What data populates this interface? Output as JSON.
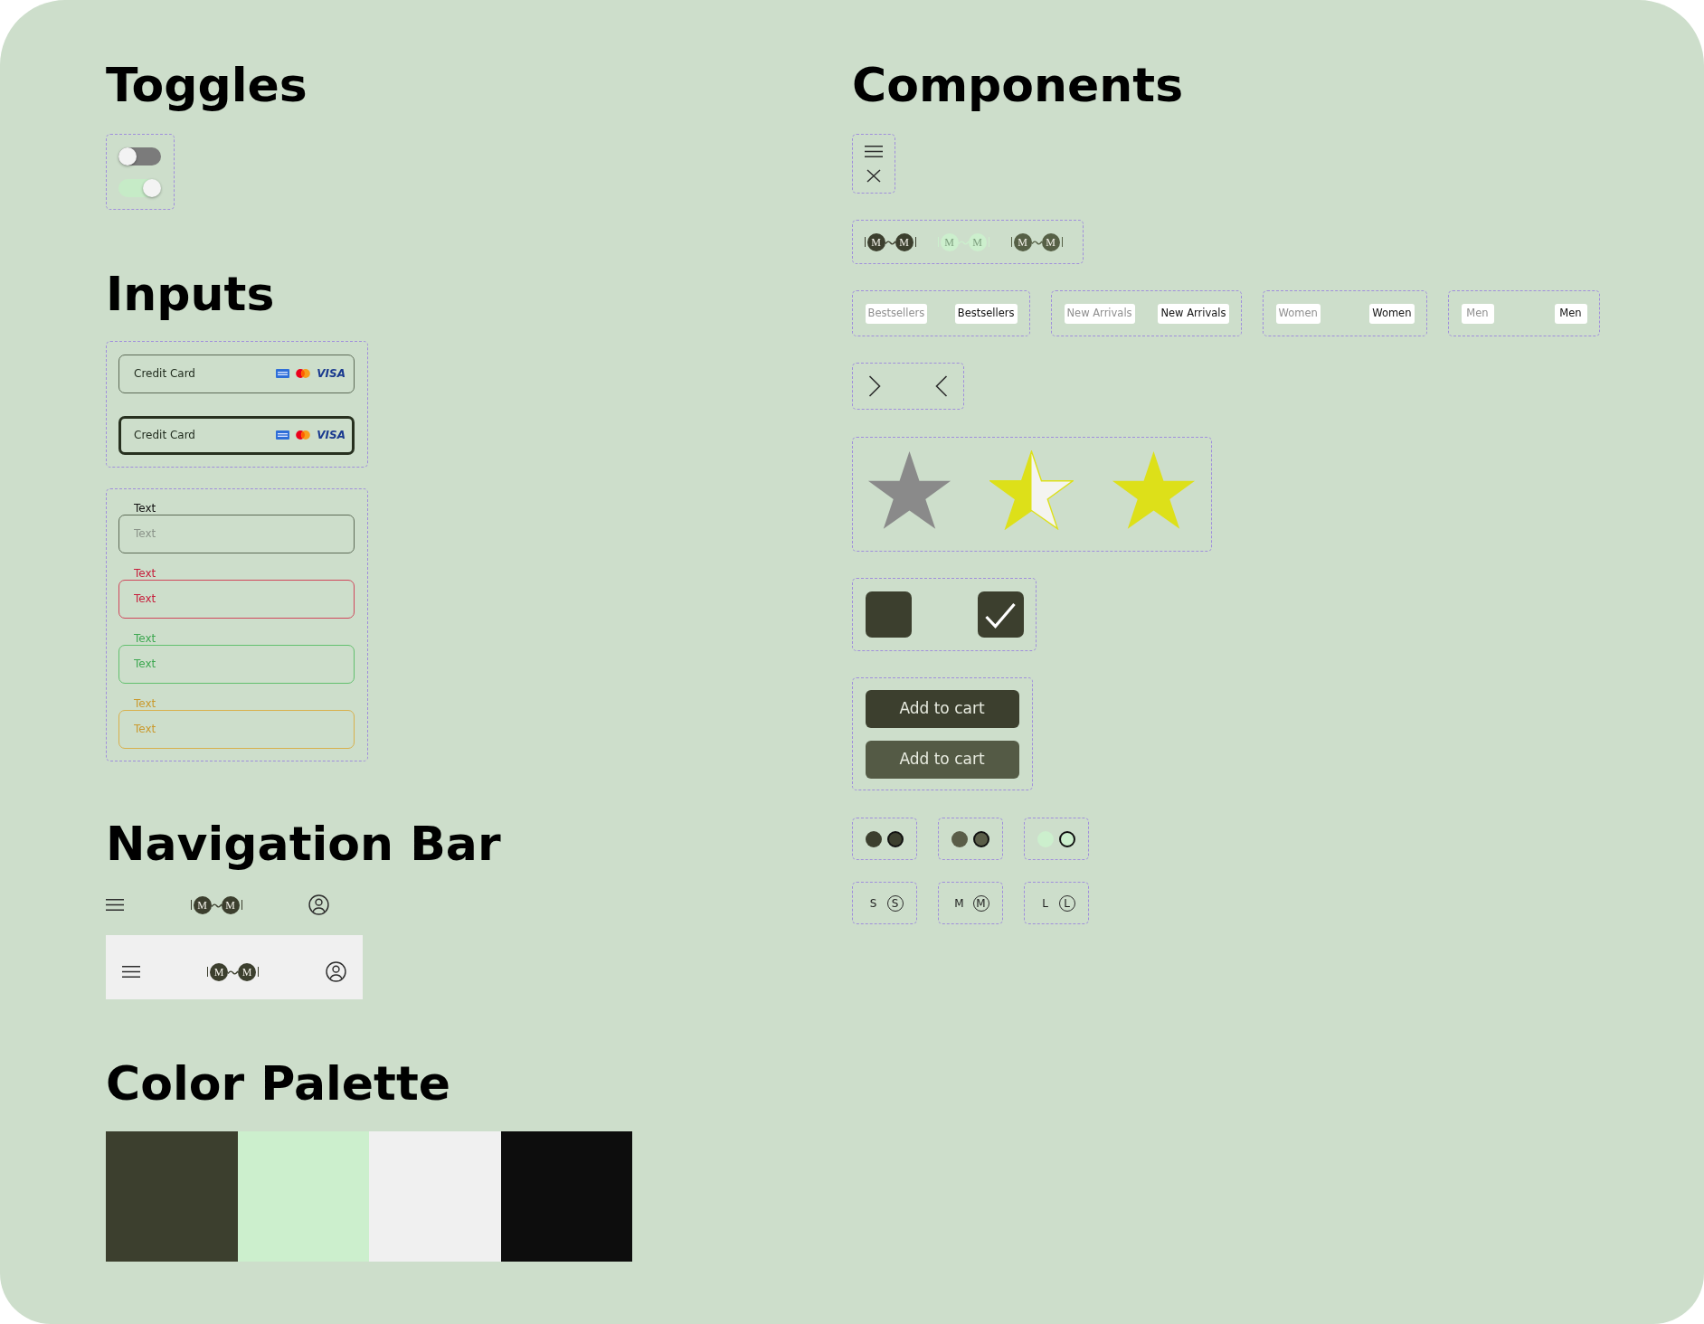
{
  "toggles": {
    "title": "Toggles",
    "items": [
      {
        "on": false
      },
      {
        "on": true
      }
    ]
  },
  "components": {
    "title": "Components",
    "logo_variants": [
      {
        "color": "#3c3f2e",
        "letters": [
          "M",
          "M"
        ]
      },
      {
        "color": "#ccefcd",
        "letters": [
          "M",
          "M"
        ]
      },
      {
        "color": "#566046",
        "letters": [
          "M",
          "M"
        ]
      }
    ],
    "tab_groups": [
      {
        "tabs": [
          {
            "label": "Bestsellers",
            "selected": false
          },
          {
            "label": "Bestsellers",
            "selected": true
          }
        ]
      },
      {
        "tabs": [
          {
            "label": "New Arrivals",
            "selected": false
          },
          {
            "label": "New Arrivals",
            "selected": true
          }
        ]
      },
      {
        "tabs": [
          {
            "label": "Women",
            "selected": false
          },
          {
            "label": "Women",
            "selected": true
          }
        ]
      },
      {
        "tabs": [
          {
            "label": "Men",
            "selected": false
          },
          {
            "label": "Men",
            "selected": true
          }
        ]
      }
    ],
    "star_states": [
      {
        "kind": "empty"
      },
      {
        "kind": "half"
      },
      {
        "kind": "full"
      }
    ],
    "checkboxes": [
      {
        "checked": false
      },
      {
        "checked": true
      }
    ],
    "buttons": [
      {
        "label": "Add to cart",
        "hovered": false
      },
      {
        "label": "Add to cart",
        "hovered": true
      }
    ],
    "color_options": [
      {
        "dots": [
          {
            "color": "#3c3f2e",
            "selected": false
          },
          {
            "color": "#3c3f2e",
            "selected": true
          }
        ]
      },
      {
        "dots": [
          {
            "color": "#5a5d48",
            "selected": false
          },
          {
            "color": "#5a5d48",
            "selected": true
          }
        ]
      },
      {
        "dots": [
          {
            "color": "#ccefcd",
            "selected": false
          },
          {
            "color": "#ccefcd",
            "selected": true
          }
        ]
      }
    ],
    "size_options": [
      {
        "chips": [
          {
            "label": "S",
            "selected": false
          },
          {
            "label": "S",
            "selected": true
          }
        ]
      },
      {
        "chips": [
          {
            "label": "M",
            "selected": false
          },
          {
            "label": "M",
            "selected": true
          }
        ]
      },
      {
        "chips": [
          {
            "label": "L",
            "selected": false
          },
          {
            "label": "L",
            "selected": true
          }
        ]
      }
    ]
  },
  "inputs": {
    "title": "Inputs",
    "card_fields": [
      {
        "placeholder": "Credit Card",
        "focused": false,
        "brands": [
          {
            "kind": "card"
          },
          {
            "kind": "circles"
          },
          {
            "kind": "wordmark",
            "text": "VISA"
          }
        ]
      },
      {
        "placeholder": "Credit Card",
        "focused": true,
        "brands": [
          {
            "kind": "card"
          },
          {
            "kind": "circles"
          },
          {
            "kind": "wordmark",
            "text": "VISA"
          }
        ]
      }
    ],
    "text_fields": [
      {
        "label": "Text",
        "placeholder": "Text",
        "kind": "default"
      },
      {
        "label": "Text",
        "placeholder": "Text",
        "kind": "error"
      },
      {
        "label": "Text",
        "placeholder": "Text",
        "kind": "success"
      },
      {
        "label": "Text",
        "placeholder": "Text",
        "kind": "warning"
      }
    ]
  },
  "navigation_bar": {
    "title": "Navigation Bar",
    "variants": [
      {
        "kind": "transparent",
        "logo_letters": [
          "M",
          "M"
        ]
      },
      {
        "kind": "filled",
        "logo_letters": [
          "M",
          "M"
        ]
      }
    ]
  },
  "color_palette": {
    "title": "Color Palette",
    "swatches": [
      {
        "color": "#3c3f2e"
      },
      {
        "color": "#ccefcd"
      },
      {
        "color": "#f0f0f0"
      },
      {
        "color": "#0d0d0d"
      }
    ]
  }
}
